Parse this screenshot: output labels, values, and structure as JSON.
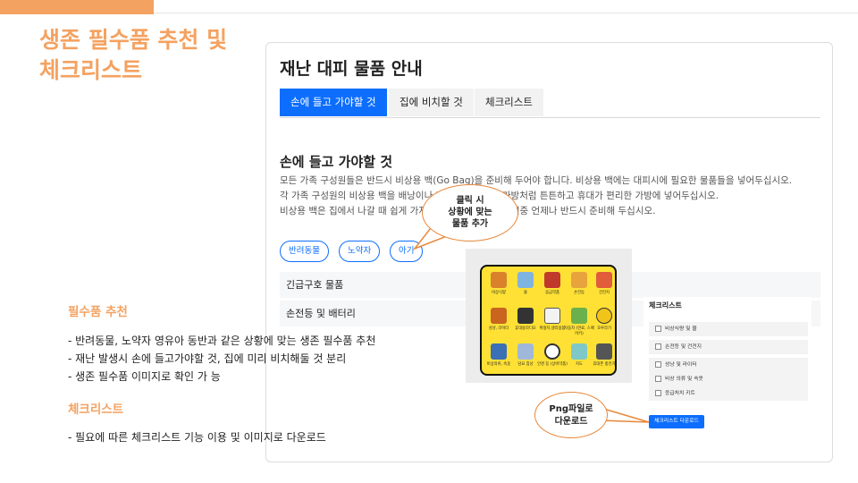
{
  "slide": {
    "title_line1": "생존 필수품 추천 및",
    "title_line2": "체크리스트",
    "accent_color": "#f4a261"
  },
  "panel": {
    "title": "재난 대피 물품 안내",
    "tabs": [
      {
        "label": "손에 들고 가야할 것",
        "active": true
      },
      {
        "label": "집에 비치할 것",
        "active": false
      },
      {
        "label": "체크리스트",
        "active": false
      }
    ],
    "section_title": "손에 들고 가야할 것",
    "desc_lines": [
      "모든 가족 구성원들은 반드시 비상용 백(Go Bag)을 준비해 두어야 합니다. 비상용 백에는 대피시에 필요한 물품들을 넣어두십시오.",
      "각 가족 구성원의 비상용 백을 배낭이나 바퀴달린 여행용 가방처럼 튼튼하고 휴대가 편리한 가방에 넣어두십시오.",
      "비상용 백은 집에서 나갈 때 쉽게 가져갈 수 있어야 합니다. 연중 언제나 반드시 준비해 두십시오."
    ],
    "filters": [
      "반려동물",
      "노약자",
      "아기"
    ],
    "accordion": [
      "긴급구호 물품",
      "손전등 및 배터리"
    ]
  },
  "items_image": {
    "labels": [
      "비상식량",
      "물",
      "응급약품",
      "손전등",
      "건전지",
      "성냥, 라이터",
      "휴대용라디오",
      "위생지,생리용품",
      "자동차 (연료, 스페어키)",
      "호루라기",
      "비상의류, 속옷",
      "담요 침낭",
      "안경 등 (상비약품)",
      "지도",
      "휴대폰 충전기"
    ]
  },
  "checklist": {
    "title": "체크리스트",
    "items": [
      "비상식량 및 물",
      "손전등 및 건전지",
      "성냥 및 라이터",
      "비상 의류 및 속옷",
      "응급처치 키트"
    ],
    "download_button": "체크리스트 다운로드"
  },
  "callouts": {
    "click": [
      "클릭 시",
      "상황에 맞는",
      "물품 추가"
    ],
    "png": [
      "Png파일로",
      "다운로드"
    ]
  },
  "sidebar": {
    "heading1": "필수품 추천",
    "lines1": [
      "- 반려동물, 노약자 영유아 동반과 같은 상황에 맞는 생존 필수품 추천",
      "- 재난 발생시 손에 들고가야할 것, 집에 미리 비치해둘 것 분리",
      "- 생존 필수품 이미지로 확인 가 능"
    ],
    "heading2": "체크리스트",
    "lines2": [
      "- 필요에 따른 체크리스트 기능 이용 및 이미지로 다운로드"
    ]
  }
}
